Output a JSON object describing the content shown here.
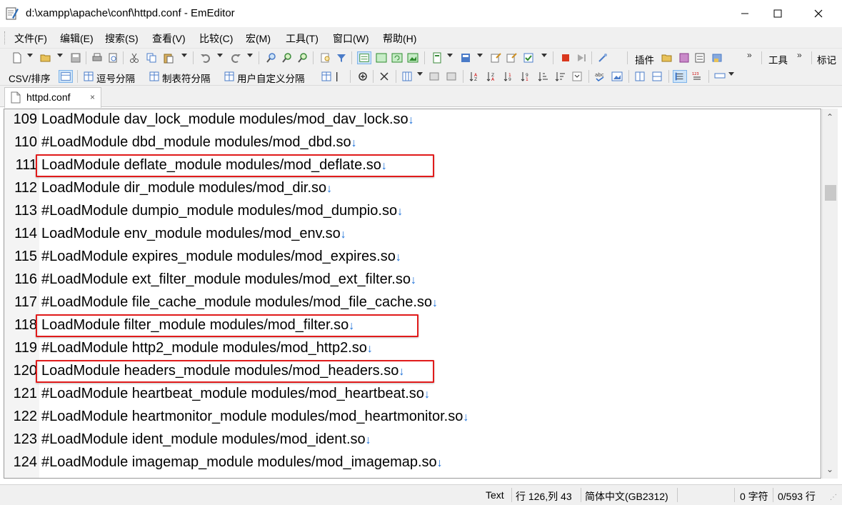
{
  "window": {
    "title": "d:\\xampp\\apache\\conf\\httpd.conf - EmEditor"
  },
  "menu": {
    "items": [
      "文件(F)",
      "编辑(E)",
      "搜索(S)",
      "查看(V)",
      "比较(C)",
      "宏(M)",
      "工具(T)",
      "窗口(W)",
      "帮助(H)"
    ]
  },
  "toolbar1": {
    "plugins_label": "插件",
    "tools_label": "工具",
    "marks_label": "标记"
  },
  "toolbar2": {
    "csv_label": "CSV/排序",
    "comma_label": "逗号分隔",
    "tab_sep_label": "制表符分隔",
    "user_sep_label": "用户自定义分隔"
  },
  "tab": {
    "label": "httpd.conf",
    "close": "×"
  },
  "editor": {
    "eol_mark": "↓",
    "lines": [
      {
        "num": "109",
        "text": "LoadModule dav_lock_module modules/mod_dav_lock.so",
        "highlight": false
      },
      {
        "num": "110",
        "text": "#LoadModule dbd_module modules/mod_dbd.so",
        "highlight": false
      },
      {
        "num": "111",
        "text": "LoadModule deflate_module modules/mod_deflate.so",
        "highlight": true
      },
      {
        "num": "112",
        "text": "LoadModule dir_module modules/mod_dir.so",
        "highlight": false
      },
      {
        "num": "113",
        "text": "#LoadModule dumpio_module modules/mod_dumpio.so",
        "highlight": false
      },
      {
        "num": "114",
        "text": "LoadModule env_module modules/mod_env.so",
        "highlight": false
      },
      {
        "num": "115",
        "text": "#LoadModule expires_module modules/mod_expires.so",
        "highlight": false
      },
      {
        "num": "116",
        "text": "#LoadModule ext_filter_module modules/mod_ext_filter.so",
        "highlight": false
      },
      {
        "num": "117",
        "text": "#LoadModule file_cache_module modules/mod_file_cache.so",
        "highlight": false
      },
      {
        "num": "118",
        "text": "LoadModule filter_module modules/mod_filter.so",
        "highlight": true
      },
      {
        "num": "119",
        "text": "#LoadModule http2_module modules/mod_http2.so",
        "highlight": false
      },
      {
        "num": "120",
        "text": "LoadModule headers_module modules/mod_headers.so",
        "highlight": true
      },
      {
        "num": "121",
        "text": "#LoadModule heartbeat_module modules/mod_heartbeat.so",
        "highlight": false
      },
      {
        "num": "122",
        "text": "#LoadModule heartmonitor_module modules/mod_heartmonitor.so",
        "highlight": false
      },
      {
        "num": "123",
        "text": "#LoadModule ident_module modules/mod_ident.so",
        "highlight": false
      },
      {
        "num": "124",
        "text": "#LoadModule imagemap_module modules/mod_imagemap.so",
        "highlight": false
      }
    ]
  },
  "status": {
    "mode": "Text",
    "position": "行 126,列 43",
    "encoding": "简体中文(GB2312)",
    "chars": "0 字符",
    "lines": "0/593 行"
  },
  "colors": {
    "highlight_border": "#e11b1b",
    "eol_mark": "#1a6fd8",
    "chrome_bg": "#f0f0f0"
  }
}
